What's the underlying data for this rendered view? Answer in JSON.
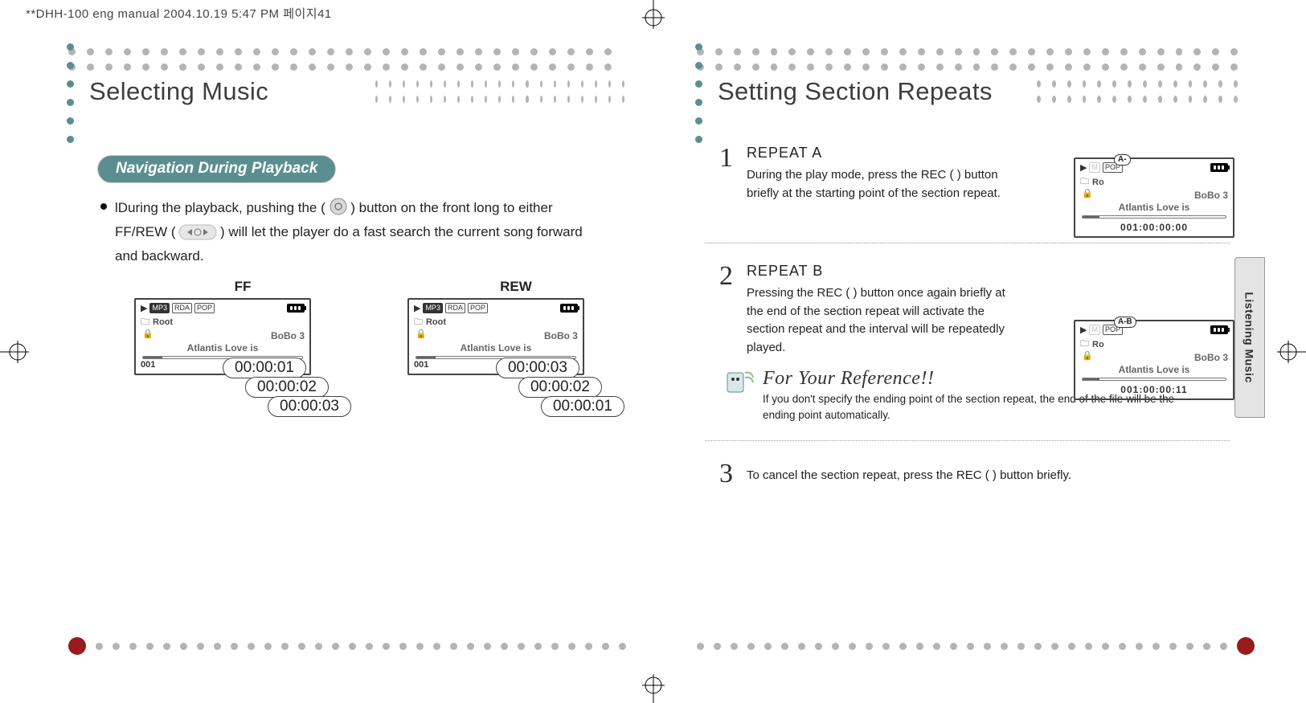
{
  "print_note": "**DHH-100 eng manual  2004.10.19 5:47 PM  페이지41",
  "edge_tab": "Listening Music",
  "left": {
    "title": "Selecting Music",
    "pill": "Navigation During Playback",
    "para_a": "lDuring the playback, pushing the (",
    "para_b": ") button on the front long to either FF/REW (",
    "para_c": ") will let the player do a fast search the current song forward and backward.",
    "ff_label": "FF",
    "rew_label": "REW",
    "lcd": {
      "tag_mp3": "MP3",
      "tag_rda": "RDA",
      "tag_pop": "POP",
      "root": "Root",
      "artist": "BoBo 3",
      "track": "Atlantis Love is",
      "idx": "001"
    },
    "ff_times": [
      "00:00:01",
      "00:00:02",
      "00:00:03"
    ],
    "rew_times": [
      "00:00:03",
      "00:00:02",
      "00:00:01"
    ]
  },
  "right": {
    "title": "Setting Section Repeats",
    "step1_num": "1",
    "step1_title": "REPEAT A",
    "step1_text": "During the play mode, press the REC (    ) button briefly at the starting point of the section repeat.",
    "step2_num": "2",
    "step2_title": "REPEAT B",
    "step2_text": "Pressing the REC (    ) button once again briefly at the end of the section repeat will activate the section repeat and the interval will be repeatedly played.",
    "step3_num": "3",
    "step3_text": "To cancel the section repeat, press the REC (    ) button briefly.",
    "ref_title": "For Your Reference!!",
    "ref_text": "If you don't specify the ending point of the section repeat, the end of the file will be the ending point automatically.",
    "lcd1": {
      "tag_a": "A-",
      "tag_pop": "POP",
      "root_pfx": "Ro",
      "artist": "BoBo 3",
      "track": "Atlantis Love is",
      "time": "001:00:00:00"
    },
    "lcd2": {
      "tag_ab": "A-B",
      "tag_pop": "POP",
      "root_pfx": "Ro",
      "artist": "BoBo 3",
      "track": "Atlantis Love is",
      "time": "001:00:00:11"
    }
  }
}
